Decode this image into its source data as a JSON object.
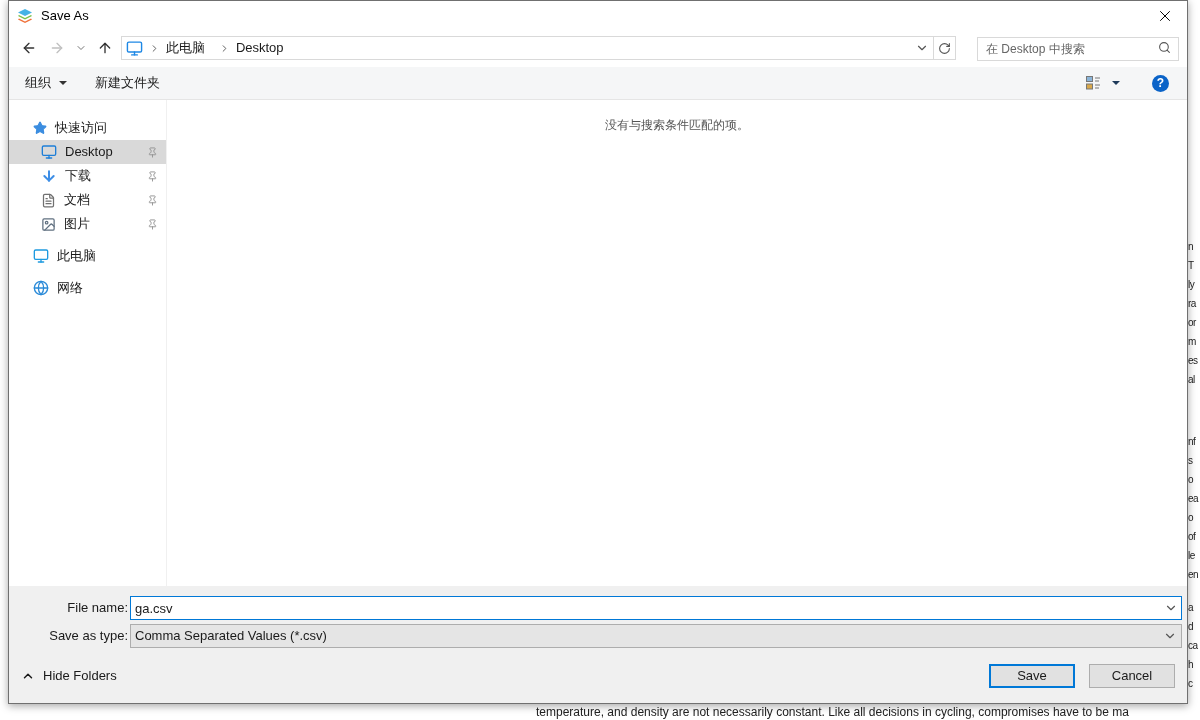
{
  "window": {
    "title": "Save As"
  },
  "address": {
    "back_enabled": true,
    "forward_enabled": false,
    "path": [
      "此电脑",
      "Desktop"
    ]
  },
  "search": {
    "placeholder": "在 Desktop 中搜索"
  },
  "toolbar": {
    "organize": "组织",
    "new_folder": "新建文件夹"
  },
  "nav": [
    {
      "label": "快速访问",
      "kind": "star",
      "selected": false,
      "children": [
        {
          "label": "Desktop",
          "kind": "desktop",
          "selected": true,
          "pinned": true
        },
        {
          "label": "下载",
          "kind": "download",
          "selected": false,
          "pinned": true
        },
        {
          "label": "文档",
          "kind": "document",
          "selected": false,
          "pinned": true
        },
        {
          "label": "图片",
          "kind": "picture",
          "selected": false,
          "pinned": true
        }
      ]
    },
    {
      "label": "此电脑",
      "kind": "computer",
      "selected": false
    },
    {
      "label": "网络",
      "kind": "network",
      "selected": false
    }
  ],
  "content": {
    "empty_message": "没有与搜索条件匹配的项。"
  },
  "file_name": {
    "label": "File name:",
    "value": "ga.csv"
  },
  "save_type": {
    "label": "Save as type:",
    "value": "Comma Separated Values (*.csv)"
  },
  "hide_folders": "Hide Folders",
  "help_button": "?",
  "buttons": [
    {
      "label": "Save",
      "default": true
    },
    {
      "label": "Cancel",
      "default": false
    }
  ],
  "background": {
    "side_fragments": [
      "n",
      "T",
      "ly",
      "ra",
      "or",
      "m",
      "es",
      "al",
      "nf",
      "s",
      "o",
      "ea",
      "o",
      "of",
      "le",
      "en",
      "a",
      "d",
      "ca",
      "h",
      "c"
    ],
    "bottom_line": "temperature, and density are not necessarily constant. Like all decisions in cycling, compromises have to be ma"
  }
}
